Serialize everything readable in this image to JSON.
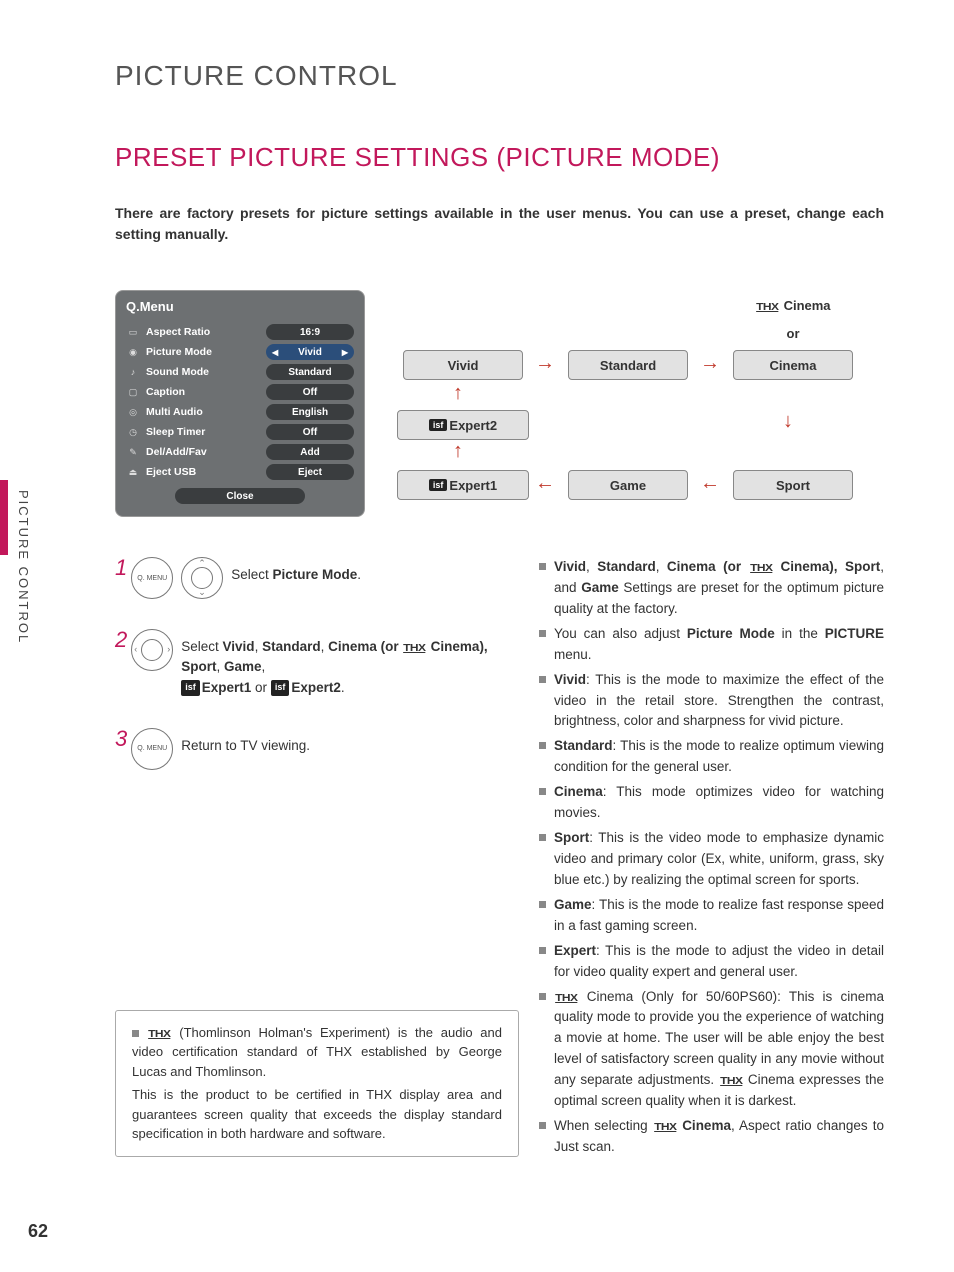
{
  "chapter": "PICTURE CONTROL",
  "section": "PRESET PICTURE SETTINGS (PICTURE MODE)",
  "intro": "There are factory presets for picture settings available in the user menus. You can use a preset, change each setting manually.",
  "side_tab": "PICTURE CONTROL",
  "page_number": "62",
  "qmenu": {
    "title": "Q.Menu",
    "rows": [
      {
        "label": "Aspect Ratio",
        "value": "16:9"
      },
      {
        "label": "Picture Mode",
        "value": "Vivid",
        "selected": true
      },
      {
        "label": "Sound Mode",
        "value": "Standard"
      },
      {
        "label": "Caption",
        "value": "Off"
      },
      {
        "label": "Multi Audio",
        "value": "English"
      },
      {
        "label": "Sleep Timer",
        "value": "Off"
      },
      {
        "label": "Del/Add/Fav",
        "value": "Add"
      },
      {
        "label": "Eject USB",
        "value": "Eject"
      }
    ],
    "close": "Close"
  },
  "flow": {
    "thx_cinema_label": "Cinema",
    "or": "or",
    "vivid": "Vivid",
    "standard": "Standard",
    "cinema": "Cinema",
    "sport": "Sport",
    "game": "Game",
    "expert1": "Expert1",
    "expert2": "Expert2"
  },
  "steps": {
    "btn_label": "Q. MENU",
    "s1": "Select ",
    "s1b": "Picture Mode",
    "s1end": ".",
    "s2a": "Select ",
    "s2b": "Vivid",
    "s2c": ", ",
    "s2d": "Standard",
    "s2e": ", ",
    "s2f": "Cinema",
    "s2g": " (or ",
    "s2h": "Cinema",
    "s2i": "), ",
    "s2j": "Sport",
    "s2k": ", ",
    "s2l": "Game",
    "s2m": ", ",
    "s2n": "Expert1",
    "s2o": " or ",
    "s2p": "Expert2",
    "s2q": ".",
    "s3": "Return to TV viewing."
  },
  "bullets": {
    "b1a": "Vivid",
    "b1b": ", ",
    "b1c": "Standard",
    "b1d": ", ",
    "b1e": "Cinema",
    "b1f": " (or ",
    "b1g": "Cinema",
    "b1h": "), ",
    "b1i": "Sport",
    "b1j": ", and ",
    "b1k": "Game",
    "b1l": " Settings are preset for the optimum picture quality at the factory.",
    "b2a": "You can also adjust ",
    "b2b": "Picture Mode",
    "b2c": " in the ",
    "b2d": "PICTURE",
    "b2e": " menu.",
    "b3a": "Vivid",
    "b3b": ": This is the mode to maximize the effect of the video in the retail store. Strengthen the contrast, brightness, color and sharpness for vivid picture.",
    "b4a": "Standard",
    "b4b": ": This is the mode to realize optimum viewing condition for the general user.",
    "b5a": "Cinema",
    "b5b": ": This mode optimizes video for watching movies.",
    "b6a": "Sport",
    "b6b": ": This is the video mode to emphasize dynamic video and primary color (Ex, white, uniform, grass, sky blue etc.) by realizing the optimal screen for sports.",
    "b7a": "Game",
    "b7b": ": This is the mode to realize fast response speed in a fast gaming screen.",
    "b8a": "Expert",
    "b8b": ": This is the mode to adjust the video in detail for video quality expert and general user.",
    "b9a": "Cinema (Only for 50/60PS60): This is cinema quality mode to provide you the experience of watching a movie at home. The user will be able enjoy the best level of satisfactory screen quality in any movie without any separate adjustments. ",
    "b9b": " Cinema expresses the optimal screen quality when it is darkest.",
    "b10a": "When selecting ",
    "b10b": "Cinema",
    "b10c": ", Aspect ratio changes to Just scan."
  },
  "note": {
    "p1": " (Thomlinson Holman's Experiment) is the audio and video certification standard of THX established by George Lucas and Thomlinson.",
    "p2": "This is the product to be certified in THX display area and guarantees screen quality that exceeds the display standard specification in both hardware and software."
  },
  "thx_label": "THX"
}
